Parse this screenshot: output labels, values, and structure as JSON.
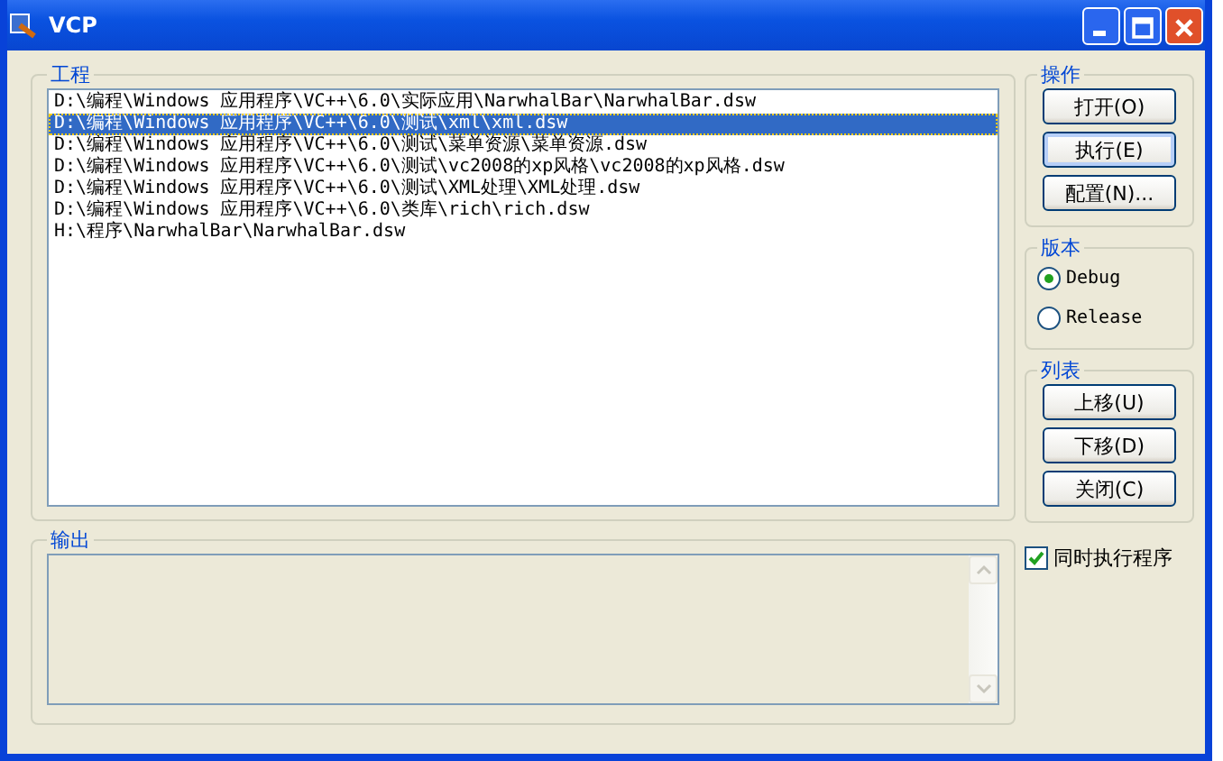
{
  "window": {
    "title": "VCP"
  },
  "project": {
    "title": "工程",
    "items": [
      {
        "text": "D:\\编程\\Windows 应用程序\\VC++\\6.0\\实际应用\\NarwhalBar\\NarwhalBar.dsw",
        "selected": false
      },
      {
        "text": "D:\\编程\\Windows 应用程序\\VC++\\6.0\\测试\\xml\\xml.dsw",
        "selected": true
      },
      {
        "text": "D:\\编程\\Windows 应用程序\\VC++\\6.0\\测试\\菜单资源\\菜单资源.dsw",
        "selected": false
      },
      {
        "text": "D:\\编程\\Windows 应用程序\\VC++\\6.0\\测试\\vc2008的xp风格\\vc2008的xp风格.dsw",
        "selected": false
      },
      {
        "text": "D:\\编程\\Windows 应用程序\\VC++\\6.0\\测试\\XML处理\\XML处理.dsw",
        "selected": false
      },
      {
        "text": "D:\\编程\\Windows 应用程序\\VC++\\6.0\\类库\\rich\\rich.dsw",
        "selected": false
      },
      {
        "text": "H:\\程序\\NarwhalBar\\NarwhalBar.dsw",
        "selected": false
      }
    ]
  },
  "output": {
    "title": "输出"
  },
  "actions": {
    "title": "操作",
    "buttons": [
      {
        "label": "打开(O)",
        "focused": false
      },
      {
        "label": "执行(E)",
        "focused": true
      },
      {
        "label": "配置(N)...",
        "focused": false
      }
    ]
  },
  "version": {
    "title": "版本",
    "options": [
      {
        "label": "Debug",
        "selected": true
      },
      {
        "label": "Release",
        "selected": false
      }
    ]
  },
  "list": {
    "title": "列表",
    "buttons": [
      "上移(U)",
      "下移(D)",
      "关闭(C)"
    ]
  },
  "run_together": {
    "label": "同时执行程序",
    "checked": true
  }
}
